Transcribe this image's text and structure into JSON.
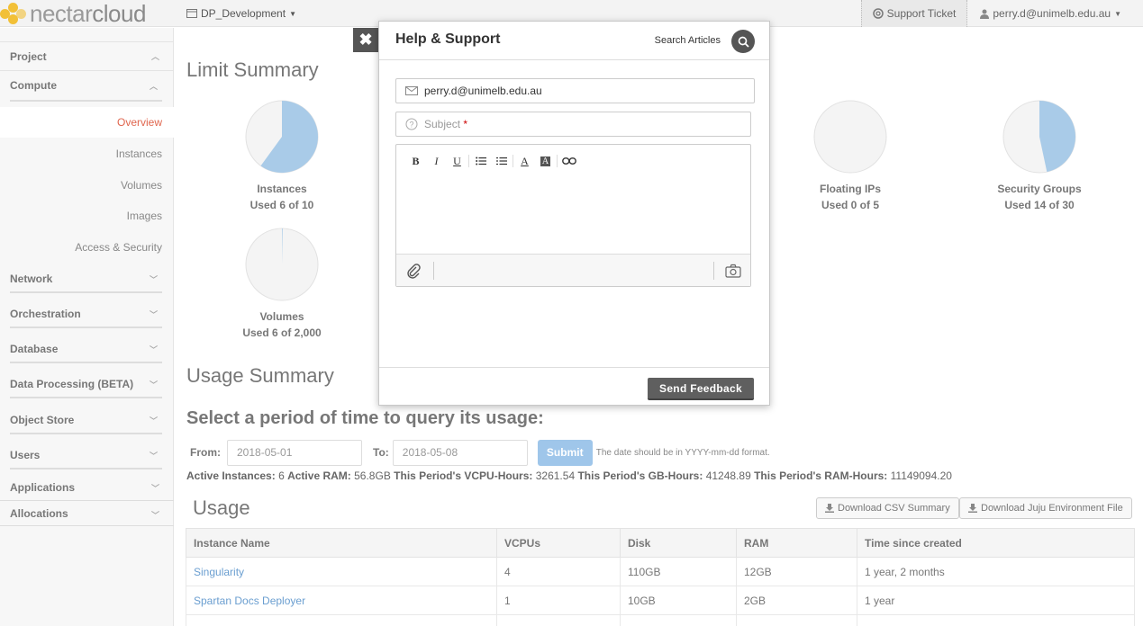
{
  "brand": {
    "name_part1": "nectar",
    "name_part2": "cloud",
    "logo_color": "#f2c037"
  },
  "topbar": {
    "project": "DP_Development",
    "support_ticket": "Support Ticket",
    "user": "perry.d@unimelb.edu.au"
  },
  "sidebar": {
    "project": "Project",
    "compute": "Compute",
    "items": [
      "Overview",
      "Instances",
      "Volumes",
      "Images",
      "Access & Security"
    ],
    "sections": [
      "Network",
      "Orchestration",
      "Database",
      "Data Processing (BETA)",
      "Object Store",
      "Users",
      "Applications",
      "Allocations"
    ]
  },
  "main": {
    "limit_title": "Limit Summary",
    "limits": [
      {
        "label": "Instances",
        "used_text": "Used 6 of 10",
        "used": 6,
        "total": 10
      },
      {
        "label": "Floating IPs",
        "used_text": "Used 0 of 5",
        "used": 0,
        "total": 5
      },
      {
        "label": "Security Groups",
        "used_text": "Used 14 of 30",
        "used": 14,
        "total": 30
      },
      {
        "label": "Volumes",
        "used_text": "Used 6 of 2,000",
        "used": 6,
        "total": 2000
      }
    ],
    "usage_title": "Usage Summary",
    "period_title": "Select a period of time to query its usage:",
    "from_label": "From:",
    "from_value": "2018-05-01",
    "to_label": "To:",
    "to_value": "2018-05-08",
    "submit": "Submit",
    "hint": "The date should be in YYYY-mm-dd format.",
    "stats": {
      "active_instances_label": "Active Instances:",
      "active_instances": "6",
      "active_ram_label": "Active RAM:",
      "active_ram": "56.8GB",
      "vcpu_hours_label": "This Period's VCPU-Hours:",
      "vcpu_hours": "3261.54",
      "gb_hours_label": "This Period's GB-Hours:",
      "gb_hours": "41248.89",
      "ram_hours_label": "This Period's RAM-Hours:",
      "ram_hours": "11149094.20"
    },
    "usage_heading": "Usage",
    "download_csv": "Download CSV Summary",
    "download_juju": "Download Juju Environment File",
    "table": {
      "headers": [
        "Instance Name",
        "VCPUs",
        "Disk",
        "RAM",
        "Time since created"
      ],
      "rows": [
        [
          "Singularity",
          "4",
          "110GB",
          "12GB",
          "1 year, 2 months"
        ],
        [
          "Spartan Docs Deployer",
          "1",
          "10GB",
          "2GB",
          "1 year"
        ]
      ]
    }
  },
  "modal": {
    "title": "Help & Support",
    "search_articles": "Search Articles",
    "email": "perry.d@unimelb.edu.au",
    "subject_placeholder": "Subject",
    "required_mark": "*",
    "send": "Send Feedback"
  },
  "colors": {
    "accent": "#e0664e",
    "pie_fill": "#a9cbe8",
    "link": "#6a9ed0"
  }
}
